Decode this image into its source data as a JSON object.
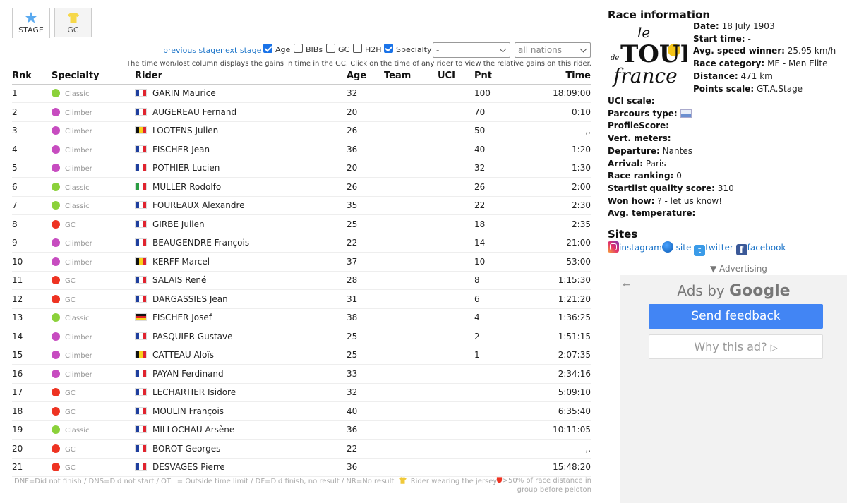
{
  "tabs": [
    {
      "label": "STAGE",
      "icon": "star-icon",
      "active": true
    },
    {
      "label": "GC",
      "icon": "yellow-jersey-icon",
      "active": false
    }
  ],
  "controls": {
    "previous_stage": "previous stage",
    "next_stage": "next stage",
    "age_label": "Age",
    "bibs_label": "BIBs",
    "gc_label": "GC",
    "h2h_label": "H2H",
    "specialty_label": "Specialty",
    "select_value": "-",
    "nations_value": "all nations"
  },
  "note": "The time won/lost column displays the gains in time in the GC. Click on the time of any rider to view the relative gains on this rider.",
  "table": {
    "headers": {
      "rnk": "Rnk",
      "specialty": "Specialty",
      "rider": "Rider",
      "age": "Age",
      "team": "Team",
      "uci": "UCI",
      "pnt": "Pnt",
      "time": "Time"
    },
    "rows": [
      {
        "rnk": "1",
        "spec": "Classic",
        "nat": "fr",
        "rider": "GARIN Maurice",
        "age": "32",
        "team": "",
        "uci": "",
        "pnt": "100",
        "time": "18:09:00"
      },
      {
        "rnk": "2",
        "spec": "Climber",
        "nat": "fr",
        "rider": "AUGEREAU Fernand",
        "age": "20",
        "team": "",
        "uci": "",
        "pnt": "70",
        "time": "0:10"
      },
      {
        "rnk": "3",
        "spec": "Climber",
        "nat": "be",
        "rider": "LOOTENS Julien",
        "age": "26",
        "team": "",
        "uci": "",
        "pnt": "50",
        "time": ",,"
      },
      {
        "rnk": "4",
        "spec": "Climber",
        "nat": "fr",
        "rider": "FISCHER Jean",
        "age": "36",
        "team": "",
        "uci": "",
        "pnt": "40",
        "time": "1:20"
      },
      {
        "rnk": "5",
        "spec": "Climber",
        "nat": "fr",
        "rider": "POTHIER Lucien",
        "age": "20",
        "team": "",
        "uci": "",
        "pnt": "32",
        "time": "1:30"
      },
      {
        "rnk": "6",
        "spec": "Classic",
        "nat": "it",
        "rider": "MULLER Rodolfo",
        "age": "26",
        "team": "",
        "uci": "",
        "pnt": "26",
        "time": "2:00"
      },
      {
        "rnk": "7",
        "spec": "Classic",
        "nat": "fr",
        "rider": "FOUREAUX Alexandre",
        "age": "35",
        "team": "",
        "uci": "",
        "pnt": "22",
        "time": "2:30"
      },
      {
        "rnk": "8",
        "spec": "GC",
        "nat": "fr",
        "rider": "GIRBE Julien",
        "age": "25",
        "team": "",
        "uci": "",
        "pnt": "18",
        "time": "2:35"
      },
      {
        "rnk": "9",
        "spec": "Climber",
        "nat": "fr",
        "rider": "BEAUGENDRE François",
        "age": "22",
        "team": "",
        "uci": "",
        "pnt": "14",
        "time": "21:00"
      },
      {
        "rnk": "10",
        "spec": "Climber",
        "nat": "be",
        "rider": "KERFF Marcel",
        "age": "37",
        "team": "",
        "uci": "",
        "pnt": "10",
        "time": "53:00"
      },
      {
        "rnk": "11",
        "spec": "GC",
        "nat": "fr",
        "rider": "SALAIS René",
        "age": "28",
        "team": "",
        "uci": "",
        "pnt": "8",
        "time": "1:15:30"
      },
      {
        "rnk": "12",
        "spec": "GC",
        "nat": "fr",
        "rider": "DARGASSIES Jean",
        "age": "31",
        "team": "",
        "uci": "",
        "pnt": "6",
        "time": "1:21:20"
      },
      {
        "rnk": "13",
        "spec": "Classic",
        "nat": "de",
        "rider": "FISCHER Josef",
        "age": "38",
        "team": "",
        "uci": "",
        "pnt": "4",
        "time": "1:36:25"
      },
      {
        "rnk": "14",
        "spec": "Climber",
        "nat": "fr",
        "rider": "PASQUIER Gustave",
        "age": "25",
        "team": "",
        "uci": "",
        "pnt": "2",
        "time": "1:51:15"
      },
      {
        "rnk": "15",
        "spec": "Climber",
        "nat": "be",
        "rider": "CATTEAU Aloïs",
        "age": "25",
        "team": "",
        "uci": "",
        "pnt": "1",
        "time": "2:07:35"
      },
      {
        "rnk": "16",
        "spec": "Climber",
        "nat": "fr",
        "rider": "PAYAN Ferdinand",
        "age": "33",
        "team": "",
        "uci": "",
        "pnt": "",
        "time": "2:34:16"
      },
      {
        "rnk": "17",
        "spec": "GC",
        "nat": "fr",
        "rider": "LECHARTIER Isidore",
        "age": "32",
        "team": "",
        "uci": "",
        "pnt": "",
        "time": "5:09:10"
      },
      {
        "rnk": "18",
        "spec": "GC",
        "nat": "fr",
        "rider": "MOULIN François",
        "age": "40",
        "team": "",
        "uci": "",
        "pnt": "",
        "time": "6:35:40"
      },
      {
        "rnk": "19",
        "spec": "Classic",
        "nat": "fr",
        "rider": "MILLOCHAU Arsène",
        "age": "36",
        "team": "",
        "uci": "",
        "pnt": "",
        "time": "10:11:05"
      },
      {
        "rnk": "20",
        "spec": "GC",
        "nat": "fr",
        "rider": "BOROT Georges",
        "age": "22",
        "team": "",
        "uci": "",
        "pnt": "",
        "time": ",,"
      },
      {
        "rnk": "21",
        "spec": "GC",
        "nat": "fr",
        "rider": "DESVAGES Pierre",
        "age": "36",
        "team": "",
        "uci": "",
        "pnt": "",
        "time": "15:48:20"
      }
    ]
  },
  "colors": {
    "Classic": "#8bd13a",
    "Climber": "#c74cc0",
    "GC": "#ee3322",
    "link": "#1a73c8",
    "ad_button": "#4285f4"
  },
  "legend": {
    "text": "DNF=Did not finish / DNS=Did not start / OTL = Outside time limit / DF=Did finish, no result / NR=No result",
    "jersey": "Rider wearing the jersey",
    "breakaway": ">50% of race distance in group before peloton"
  },
  "race": {
    "title": "Race information",
    "logo_text": "le TOUR de FRANCE",
    "date_label": "Date:",
    "date": "18 July 1903",
    "start_label": "Start time:",
    "start": "-",
    "speed_label": "Avg. speed winner:",
    "speed": "25.95 km/h",
    "cat_label": "Race category:",
    "cat": "ME - Men Elite",
    "dist_label": "Distance:",
    "dist": "471 km",
    "points_label": "Points scale:",
    "points": "GT.A.Stage",
    "uci_label": "UCI scale:",
    "uci": "",
    "parcours_label": "Parcours type:",
    "profile_label": "ProfileScore:",
    "profile": "",
    "vert_label": "Vert. meters:",
    "vert": "",
    "dep_label": "Departure:",
    "dep": "Nantes",
    "arr_label": "Arrival:",
    "arr": "Paris",
    "rank_label": "Race ranking:",
    "rank": "0",
    "startlist_label": "Startlist quality score:",
    "startlist": "310",
    "won_label": "Won how:",
    "won": "? - let us know!",
    "temp_label": "Avg. temperature:",
    "temp": ""
  },
  "sites": {
    "title": "Sites",
    "instagram": "instagram",
    "site": "site",
    "twitter": "twitter",
    "facebook": "facebook"
  },
  "ads": {
    "advertising": "▼ Advertising",
    "ads_by": "Ads by",
    "google": "Google",
    "send_feedback": "Send feedback",
    "why": "Why this ad?"
  }
}
